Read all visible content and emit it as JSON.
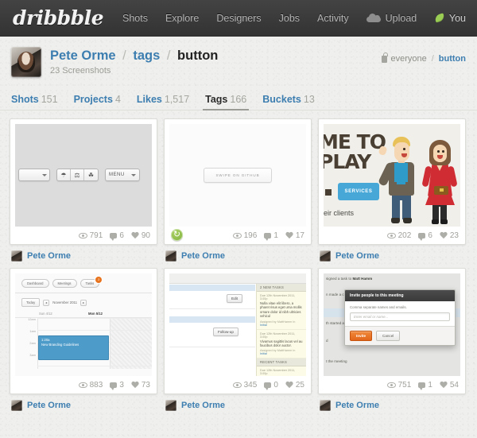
{
  "nav": {
    "logo": "dribbble",
    "links": [
      {
        "label": "Shots",
        "icon": null
      },
      {
        "label": "Explore",
        "icon": null
      },
      {
        "label": "Designers",
        "icon": null
      },
      {
        "label": "Jobs",
        "icon": null
      },
      {
        "label": "Activity",
        "icon": null
      },
      {
        "label": "Upload",
        "icon": "cloud-upload-icon"
      }
    ],
    "account": {
      "label": "You",
      "icon": "leaf-icon"
    },
    "colors": {
      "bar": "#3a3a3a",
      "link": "#b4b4b4",
      "accent": "#9acd54"
    }
  },
  "profile": {
    "avatar_alt": "Pete Orme avatar",
    "crumb_user": "Pete Orme",
    "crumb_section": "tags",
    "crumb_current": "button",
    "separator": "/",
    "shot_count": "23 Screenshots",
    "visibility": {
      "icon": "lock-icon",
      "scope": "everyone",
      "separator": "/",
      "tag": "button"
    }
  },
  "tabs": [
    {
      "label": "Shots",
      "count": "151",
      "active": false
    },
    {
      "label": "Projects",
      "count": "4",
      "active": false
    },
    {
      "label": "Likes",
      "count": "1,517",
      "active": false
    },
    {
      "label": "Tags",
      "count": "166",
      "active": true
    },
    {
      "label": "Buckets",
      "count": "13",
      "active": false
    }
  ],
  "shots": [
    {
      "id": "shot-toolbar",
      "views": "791",
      "comments": "6",
      "likes": "90",
      "author": "Pete Orme",
      "rebound": false,
      "content": {
        "kind": "toolbar",
        "menu_label": "MENU",
        "icons": [
          "umbrella-icon",
          "pin-icon",
          "tree-icon"
        ]
      }
    },
    {
      "id": "shot-swipe",
      "views": "196",
      "comments": "1",
      "likes": "17",
      "author": "Pete Orme",
      "rebound": true,
      "content": {
        "kind": "button",
        "button_label": "SWIPE ON GITHUB"
      }
    },
    {
      "id": "shot-illustration",
      "views": "202",
      "comments": "6",
      "likes": "23",
      "author": "Pete Orme",
      "rebound": false,
      "content": {
        "kind": "illustration",
        "headline_line1": "ME TO",
        "headline_line2": "PLAY",
        "cta_label": "SERVICES",
        "subtext": "eir clients"
      }
    },
    {
      "id": "shot-calendar",
      "views": "883",
      "comments": "3",
      "likes": "73",
      "author": "Pete Orme",
      "rebound": false,
      "content": {
        "kind": "calendar",
        "pills": [
          {
            "label": "Dashboard",
            "badge": null
          },
          {
            "label": "Meetings",
            "badge": null
          },
          {
            "label": "Tasks",
            "badge": "2"
          }
        ],
        "today_label": "Today",
        "prev_arrow": "◂",
        "next_arrow": "▸",
        "month_label": "November 2011",
        "day_columns": [
          "Sun 4/12",
          "Mon 5/12"
        ],
        "hour_labels": [
          "12am",
          "1am",
          "2am",
          "3am"
        ],
        "event": {
          "time": "1:20a",
          "title": "New Branding Guidelines",
          "color": "#4d9bc9"
        }
      }
    },
    {
      "id": "shot-tasks",
      "views": "345",
      "comments": "0",
      "likes": "25",
      "author": "Pete Orme",
      "rebound": false,
      "content": {
        "kind": "tasks",
        "buttons": [
          "Edit",
          "Follow-up"
        ],
        "panel_headers": [
          "2 NEW TASKS",
          "RECENT TASKS"
        ],
        "tasks": [
          {
            "due": "Due 12th November 2011, 3.00p",
            "text": "Nulla vitae elit libero, a pharet risus eget urna mollis ornare dolor id nibh ultricies vehicul",
            "assigned_prefix": "Assigned by MattHamm in ",
            "assigned_link": "Initial"
          },
          {
            "due": "Due 12th November 2011, 3.00p",
            "text": "Vivamus sagittis lacus vel au faucibus dolor auctor.",
            "assigned_prefix": "Assigned by MattHamm in ",
            "assigned_link": "Initial"
          }
        ],
        "recent_due": "Due 12th November 2011, 3.00p"
      }
    },
    {
      "id": "shot-invite-modal",
      "views": "751",
      "comments": "1",
      "likes": "54",
      "author": "Pete Orme",
      "rebound": false,
      "content": {
        "kind": "modal",
        "bg_lines": [
          {
            "prefix": "signed a task to ",
            "bold": "Matt Hamm"
          },
          {
            "prefix": "n made a co",
            "bold": ""
          },
          {
            "prefix": "",
            "bold": ""
          },
          {
            "prefix": "th started a ",
            "bold": ""
          },
          {
            "prefix": "d",
            "bold": ""
          },
          {
            "prefix": "t the meeting",
            "bold": ""
          }
        ],
        "title": "Invite people to this meeting",
        "hint": "Comma separate names and emails.",
        "input_placeholder": "Enter email or name...",
        "primary_label": "Invite",
        "secondary_label": "Cancel",
        "primary_color": "#e2651a"
      }
    }
  ],
  "stat_icons": {
    "views": "eye-icon",
    "comments": "comment-bubble-icon",
    "likes": "heart-icon",
    "rebound": "rebound-arrow-icon"
  }
}
